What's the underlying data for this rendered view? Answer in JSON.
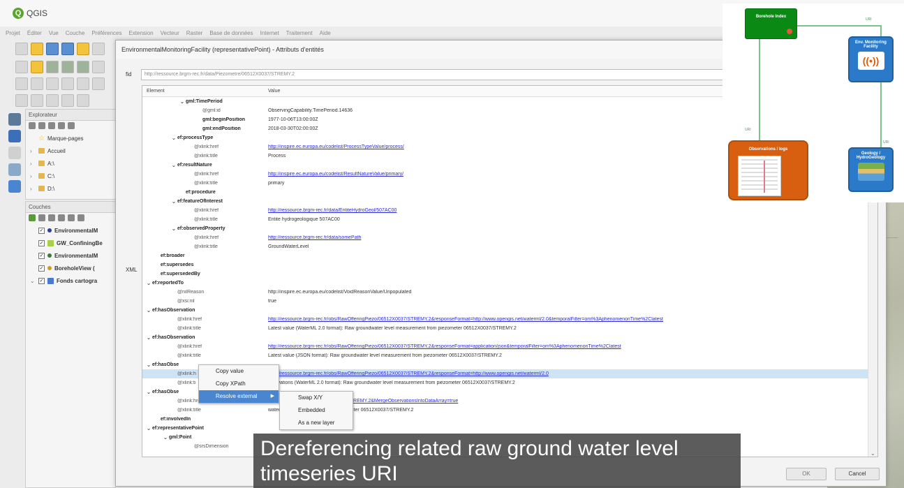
{
  "app": {
    "title": "QGIS",
    "menu": [
      "Projet",
      "Éditer",
      "Vue",
      "Couche",
      "Préférences",
      "Extension",
      "Vecteur",
      "Raster",
      "Base de données",
      "Internet",
      "Traitement",
      "Aide"
    ]
  },
  "explorer": {
    "title": "Explorateur",
    "items": [
      {
        "label": "Marque-pages",
        "icon": "star-icon"
      },
      {
        "label": "Accueil",
        "icon": "folder-icon"
      },
      {
        "label": "A:\\",
        "icon": "folder-icon"
      },
      {
        "label": "C:\\",
        "icon": "folder-icon"
      },
      {
        "label": "D:\\",
        "icon": "folder-icon"
      }
    ]
  },
  "layers": {
    "title": "Couches",
    "items": [
      {
        "label": "EnvironmentalM",
        "color": "#2a3fa0",
        "checked": true
      },
      {
        "label": "GW_ConfiningBe",
        "color": "#a6cf4a",
        "checked": true
      },
      {
        "label": "EnvironmentalM",
        "color": "#3a7a3a",
        "checked": true
      },
      {
        "label": "BoreholeView (",
        "color": "#c8a020",
        "checked": true
      },
      {
        "label": "Fonds cartogra",
        "color": "#4a7ad0",
        "checked": true
      }
    ]
  },
  "dialog": {
    "title": "EnvironmentalMonitoringFacility (representativePoint) - Attributs d'entités",
    "fid_label": "fid",
    "fid_value": "http://ressource.brgm-rec.fr/data/Piezometre/06512X0037/STREMY.2",
    "xml_label": "XML",
    "col_element": "Element",
    "col_value": "Value",
    "ok_label": "OK",
    "cancel_label": "Cancel"
  },
  "xml_rows": [
    {
      "indent": 4,
      "exp": "v",
      "name": "gml:TimePeriod",
      "value": "",
      "link": false
    },
    {
      "indent": 6,
      "exp": "",
      "name": "@gml:id",
      "attr": true,
      "value": "ObservingCapability.TimePeriod.14636",
      "link": false
    },
    {
      "indent": 6,
      "exp": "",
      "name": "gml:beginPosition",
      "value": "1977-10-06T13:00:00Z",
      "link": false
    },
    {
      "indent": 6,
      "exp": "",
      "name": "gml:endPosition",
      "value": "2018-03-30T02:00:00Z",
      "link": false
    },
    {
      "indent": 3,
      "exp": "v",
      "name": "ef:processType",
      "value": "",
      "link": false
    },
    {
      "indent": 5,
      "exp": "",
      "name": "@xlink:href",
      "attr": true,
      "value": "http://inspire.ec.europa.eu/codelist/ProcessTypeValue/process/",
      "link": true
    },
    {
      "indent": 5,
      "exp": "",
      "name": "@xlink:title",
      "attr": true,
      "value": "Process",
      "link": false
    },
    {
      "indent": 3,
      "exp": "v",
      "name": "ef:resultNature",
      "value": "",
      "link": false
    },
    {
      "indent": 5,
      "exp": "",
      "name": "@xlink:href",
      "attr": true,
      "value": "http://inspire.ec.europa.eu/codelist/ResultNatureValue/primary/",
      "link": true
    },
    {
      "indent": 5,
      "exp": "",
      "name": "@xlink:title",
      "attr": true,
      "value": "primary",
      "link": false
    },
    {
      "indent": 4,
      "exp": "",
      "name": "ef:procedure",
      "value": "",
      "link": false
    },
    {
      "indent": 3,
      "exp": "v",
      "name": "ef:featureOfInterest",
      "value": "",
      "link": false
    },
    {
      "indent": 5,
      "exp": "",
      "name": "@xlink:href",
      "attr": true,
      "value": "http://ressource.brgm-rec.fr/data/EntiteHydroGeol/507AC00",
      "link": true
    },
    {
      "indent": 5,
      "exp": "",
      "name": "@xlink:title",
      "attr": true,
      "value": "Entite hydrogeologique 507AC00",
      "link": false
    },
    {
      "indent": 3,
      "exp": "v",
      "name": "ef:observedProperty",
      "value": "",
      "link": false
    },
    {
      "indent": 5,
      "exp": "",
      "name": "@xlink:href",
      "attr": true,
      "value": "http://ressource.brgm-rec.fr/data/somePath",
      "link": true
    },
    {
      "indent": 5,
      "exp": "",
      "name": "@xlink:title",
      "attr": true,
      "value": "GroundWaterLevel",
      "link": false
    },
    {
      "indent": 1,
      "exp": "",
      "name": "ef:broader",
      "value": "",
      "link": false
    },
    {
      "indent": 1,
      "exp": "",
      "name": "ef:supersedes",
      "value": "",
      "link": false
    },
    {
      "indent": 1,
      "exp": "",
      "name": "ef:supersededBy",
      "value": "",
      "link": false
    },
    {
      "indent": 0,
      "exp": "v",
      "name": "ef:reportedTo",
      "value": "",
      "link": false
    },
    {
      "indent": 3,
      "exp": "",
      "name": "@nilReason",
      "attr": true,
      "value": "http://inspire.ec.europa.eu/codelist/VoidReasonValue/Unpopulated",
      "link": false
    },
    {
      "indent": 3,
      "exp": "",
      "name": "@xsi:nil",
      "attr": true,
      "value": "true",
      "link": false
    },
    {
      "indent": 0,
      "exp": "v",
      "name": "ef:hasObservation",
      "value": "",
      "link": false
    },
    {
      "indent": 3,
      "exp": "",
      "name": "@xlink:href",
      "attr": true,
      "value": "http://ressource.brgm-rec.fr/obs/RawOfferingPiezo/06512X0037/STREMY.2&responseFormat=http://www.opengis.net/waterml/2.0&temporalFilter=om%3AphenomenonTime%2Clatest",
      "link": true
    },
    {
      "indent": 3,
      "exp": "",
      "name": "@xlink:title",
      "attr": true,
      "value": "Latest value (WaterML 2.0 format): Raw groundwater level measurement from piezometer 06512X0037/STREMY.2",
      "link": false
    },
    {
      "indent": 0,
      "exp": "v",
      "name": "ef:hasObservation",
      "value": "",
      "link": false
    },
    {
      "indent": 3,
      "exp": "",
      "name": "@xlink:href",
      "attr": true,
      "value": "http://ressource.brgm-rec.fr/obs/RawOfferingPiezo/06512X0037/STREMY.2&responseFormat=application/json&temporalFilter=om%3AphenomenonTime%2Clatest",
      "link": true
    },
    {
      "indent": 3,
      "exp": "",
      "name": "@xlink:title",
      "attr": true,
      "value": "Latest value (JSON format): Raw groundwater level measurement from piezometer 06512X0037/STREMY.2",
      "link": false
    },
    {
      "indent": 0,
      "exp": "v",
      "name": "ef:hasObse",
      "value": "",
      "link": false
    },
    {
      "indent": 3,
      "exp": "",
      "name": "@xlink:h",
      "attr": true,
      "value": "http://ressource.brgm-rec.fr/obs/RawOfferingPiezo/06512X0037/STREMY.2&responseFormat=http://www.opengis.net/waterml/2.0",
      "link": true,
      "selected": true
    },
    {
      "indent": 3,
      "exp": "",
      "name": "@xlink:ti",
      "attr": true,
      "value": "bservations (WaterML 2.0 format): Raw groundwater level measurement from piezometer 06512X0037/STREMY.2",
      "link": false
    },
    {
      "indent": 0,
      "exp": "v",
      "name": "ef:hasObse",
      "value": "",
      "link": false
    },
    {
      "indent": 3,
      "exp": "",
      "name": "@xlink:href",
      "attr": true,
      "value": "obs/RawOfferingPiezo/06512X0037/STREMY.2&MergeObservationsIntoDataArray=true",
      "link": true
    },
    {
      "indent": 3,
      "exp": "",
      "name": "@xlink:title",
      "attr": true,
      "value": "water level measurement from piezometer 06512X0037/STREMY.2",
      "link": false
    },
    {
      "indent": 1,
      "exp": "",
      "name": "ef:involvedIn",
      "value": "",
      "link": false
    },
    {
      "indent": 0,
      "exp": "v",
      "name": "ef:representativePoint",
      "value": "",
      "link": false
    },
    {
      "indent": 2,
      "exp": "v",
      "name": "gml:Point",
      "value": "",
      "link": false
    },
    {
      "indent": 5,
      "exp": "",
      "name": "@srsDimension",
      "attr": true,
      "value": "",
      "link": false
    }
  ],
  "context_menu": {
    "items": [
      "Copy value",
      "Copy XPath",
      "Resolve external"
    ],
    "submenu": [
      "Swap X/Y",
      "Embedded",
      "As a new layer"
    ]
  },
  "caption": {
    "line1": "Dereferencing related raw ground water level",
    "line2": "timeseries URI"
  },
  "diagram": {
    "borehole": "Borehole Index",
    "env": "Env. Monitoring Facility",
    "obs": "Observations / logs",
    "geo": "Geology / HydroGeology",
    "link_label": "URI"
  }
}
